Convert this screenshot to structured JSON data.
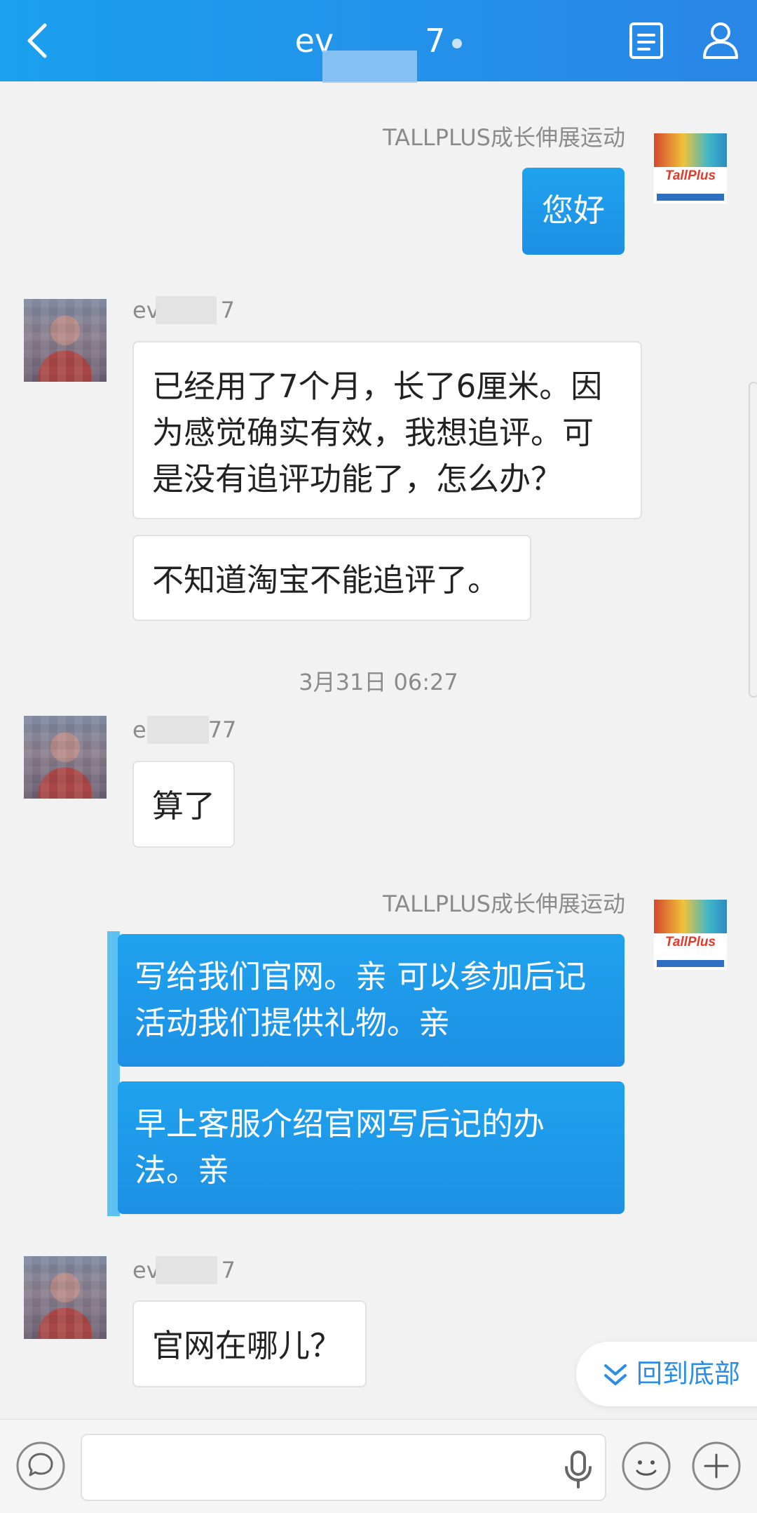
{
  "header": {
    "title": "ev7",
    "title_prefix": "ev",
    "title_suffix": "7",
    "back_icon": "chevron-left-icon",
    "doc_icon": "document-icon",
    "profile_icon": "person-icon"
  },
  "shop": {
    "name": "TALLPLUS成长伸展运动",
    "logo_text": "TallPlus"
  },
  "user": {
    "name_prefix_1": "ev",
    "name_suffix_1": "7",
    "name_prefix_2": "e",
    "name_suffix_2": "77",
    "name_prefix_3": "ev",
    "name_suffix_3": "7"
  },
  "messages": [
    {
      "from": "shop",
      "text": "您好"
    },
    {
      "from": "user",
      "text": "已经用了7个月，长了6厘米。因为感觉确实有效，我想追评。可是没有追评功能了，怎么办？"
    },
    {
      "from": "user",
      "text": "不知道淘宝不能追评了。"
    },
    {
      "from": "user",
      "text": "算了"
    },
    {
      "from": "shop",
      "text": "写给我们官网。亲 可以参加后记活动我们提供礼物。亲"
    },
    {
      "from": "shop",
      "text": "早上客服介绍官网写后记的办法。亲"
    },
    {
      "from": "user",
      "text": "官网在哪儿？"
    }
  ],
  "timestamp": "3月31日 06:27",
  "scroll_to_bottom": {
    "label": "回到底部",
    "icon": "double-chevron-down-icon"
  },
  "input": {
    "value": "",
    "placeholder": "",
    "chat_icon": "chat-bubble-icon",
    "mic_icon": "microphone-icon",
    "emoji_icon": "smiley-icon",
    "plus_icon": "plus-icon"
  },
  "colors": {
    "header_start": "#1aa0ee",
    "header_end": "#2a86e6",
    "bubble_out": "#1e96e8",
    "accent": "#2b8de6",
    "background": "#f2f2f2"
  }
}
